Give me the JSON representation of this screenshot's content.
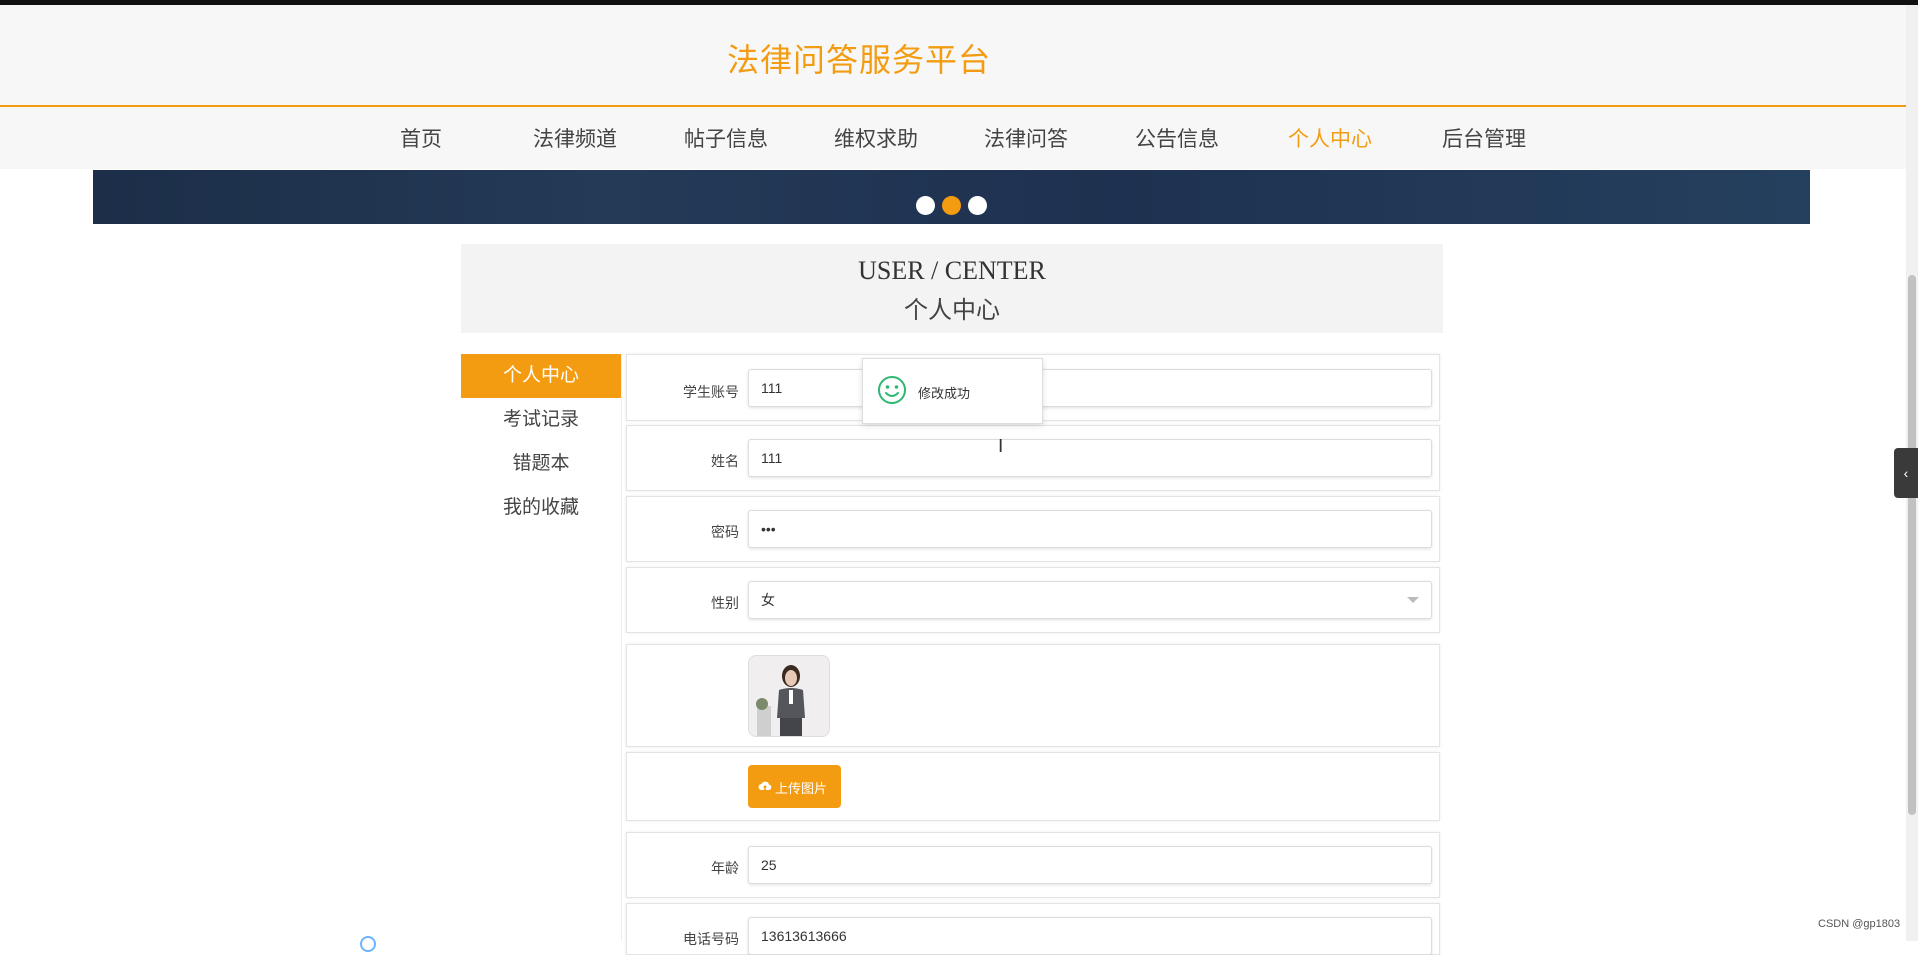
{
  "site": {
    "title": "法律问答服务平台"
  },
  "nav": {
    "items": [
      {
        "label": "首页"
      },
      {
        "label": "法律频道"
      },
      {
        "label": "帖子信息"
      },
      {
        "label": "维权求助"
      },
      {
        "label": "法律问答"
      },
      {
        "label": "公告信息"
      },
      {
        "label": "个人中心",
        "active": true
      },
      {
        "label": "后台管理"
      }
    ]
  },
  "banner": {
    "dots": 3,
    "active_dot": 2
  },
  "user_center": {
    "title_en": "USER / CENTER",
    "title_cn": "个人中心"
  },
  "sidebar": {
    "items": [
      {
        "label": "个人中心",
        "active": true
      },
      {
        "label": "考试记录"
      },
      {
        "label": "错题本"
      },
      {
        "label": "我的收藏"
      }
    ]
  },
  "form": {
    "account": {
      "label": "学生账号",
      "value": "111"
    },
    "name": {
      "label": "姓名",
      "value": "111"
    },
    "password": {
      "label": "密码",
      "value": "•••"
    },
    "gender": {
      "label": "性别",
      "value": "女"
    },
    "upload": {
      "label": "上传图片"
    },
    "age": {
      "label": "年龄",
      "value": "25"
    },
    "phone": {
      "label": "电话号码",
      "value": "13613613666"
    }
  },
  "toast": {
    "message": "修改成功"
  },
  "colors": {
    "accent": "#f39c12",
    "banner": "#1f3350"
  },
  "watermark": "CSDN @gp1803"
}
